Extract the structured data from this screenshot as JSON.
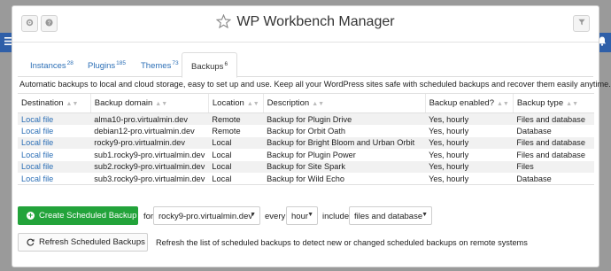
{
  "window": {
    "title": "WP Workbench Manager",
    "icons": {
      "left_edge": "menu-icon",
      "right_edge": "bell-icon",
      "gear": "gear-icon",
      "help": "help-icon",
      "star": "star-icon",
      "filter": "filter-icon"
    }
  },
  "tabs": [
    {
      "label": "Instances",
      "count": "28"
    },
    {
      "label": "Plugins",
      "count": "185"
    },
    {
      "label": "Themes",
      "count": "73"
    },
    {
      "label": "Backups",
      "count": "6"
    }
  ],
  "description": "Automatic backups to local and cloud storage, easy to set up and use. Keep all your WordPress sites safe with scheduled backups and recover them easily anytime.",
  "table": {
    "columns": [
      "Destination",
      "Backup domain",
      "Location",
      "Description",
      "Backup enabled?",
      "Backup type"
    ],
    "rows": [
      [
        "Local file",
        "alma10-pro.virtualmin.dev",
        "Remote",
        "Backup for Plugin Drive",
        "Yes, hourly",
        "Files and database"
      ],
      [
        "Local file",
        "debian12-pro.virtualmin.dev",
        "Remote",
        "Backup for Orbit Oath",
        "Yes, hourly",
        "Database"
      ],
      [
        "Local file",
        "rocky9-pro.virtualmin.dev",
        "Local",
        "Backup for Bright Bloom and Urban Orbit",
        "Yes, hourly",
        "Files and database"
      ],
      [
        "Local file",
        "sub1.rocky9-pro.virtualmin.dev",
        "Local",
        "Backup for Plugin Power",
        "Yes, hourly",
        "Files and database"
      ],
      [
        "Local file",
        "sub2.rocky9-pro.virtualmin.dev",
        "Local",
        "Backup for Site Spark",
        "Yes, hourly",
        "Files"
      ],
      [
        "Local file",
        "sub3.rocky9-pro.virtualmin.dev",
        "Local",
        "Backup for Wild Echo",
        "Yes, hourly",
        "Database"
      ]
    ]
  },
  "schedule": {
    "create_label": "Create Scheduled Backup",
    "for_label": "for",
    "domain_value": "rocky9-pro.virtualmin.dev",
    "every_label": "every",
    "interval_value": "hour",
    "include_label": "include",
    "include_value": "files and database"
  },
  "refresh": {
    "button_label": "Refresh Scheduled Backups",
    "note": "Refresh the list of scheduled backups to detect new or changed scheduled backups on remote systems"
  },
  "colors": {
    "accent": "#2f5fa8",
    "link": "#2c6fb6",
    "create_button": "#22a33a"
  }
}
